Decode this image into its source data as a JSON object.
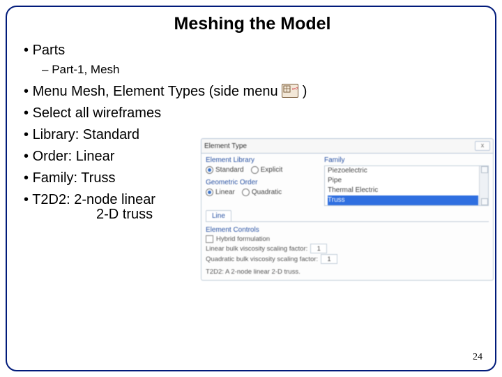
{
  "title": "Meshing the Model",
  "bullets": {
    "b0": "Parts",
    "b0_sub": "Part-1, Mesh",
    "b1_pre": "Menu Mesh, Element Types (side menu ",
    "b1_post": ")",
    "b2": "Select all wireframes",
    "b3": "Library: Standard",
    "b4": "Order: Linear",
    "b5": "Family: Truss",
    "b6_line1": "T2D2: 2-node linear",
    "b6_line2": "2-D truss"
  },
  "page_number": "24",
  "icon": {
    "name": "element-type-icon"
  },
  "dialog": {
    "title": "Element Type",
    "close": "x",
    "library_label": "Element Library",
    "library_options": {
      "standard": "Standard",
      "explicit": "Explicit"
    },
    "order_label": "Geometric Order",
    "order_options": {
      "linear": "Linear",
      "quadratic": "Quadratic"
    },
    "family_label": "Family",
    "family_items": [
      "Piezoelectric",
      "Pipe",
      "Thermal Electric",
      "Truss"
    ],
    "tab": "Line",
    "ec_label": "Element Controls",
    "ec_items": {
      "hybrid": "Hybrid formulation",
      "visc": "Linear bulk viscosity scaling factor:",
      "quad": "Quadratic bulk viscosity scaling factor:"
    },
    "ec_val": "1",
    "footer": "T2D2: A 2-node linear 2-D truss."
  }
}
